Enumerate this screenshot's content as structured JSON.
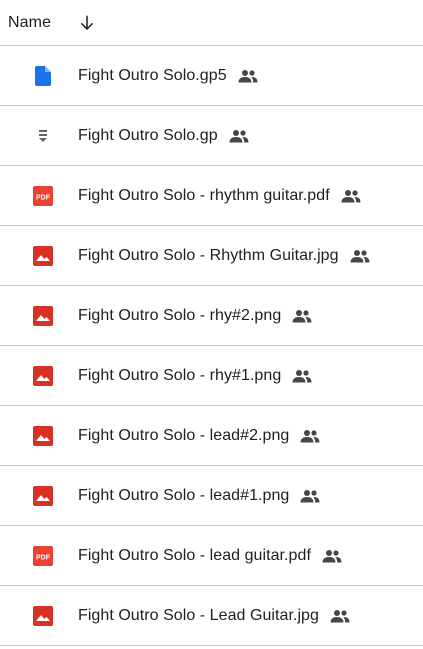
{
  "header": {
    "name_label": "Name",
    "sort_icon": "arrow-down-icon"
  },
  "colors": {
    "doc_blue": "#1a73e8",
    "pdf_red": "#ea4335",
    "image_red": "#d93025",
    "generic_gray": "#5f6368",
    "divider": "#c4c7c5"
  },
  "files": [
    {
      "name": "Fight Outro Solo.gp5",
      "type": "doc",
      "shared": true
    },
    {
      "name": "Fight Outro Solo.gp",
      "type": "generic",
      "shared": true
    },
    {
      "name": "Fight Outro Solo - rhythm guitar.pdf",
      "type": "pdf",
      "shared": true
    },
    {
      "name": "Fight Outro Solo - Rhythm Guitar.jpg",
      "type": "image",
      "shared": true
    },
    {
      "name": "Fight Outro Solo - rhy#2.png",
      "type": "image",
      "shared": true
    },
    {
      "name": "Fight Outro Solo - rhy#1.png",
      "type": "image",
      "shared": true
    },
    {
      "name": "Fight Outro Solo - lead#2.png",
      "type": "image",
      "shared": true
    },
    {
      "name": "Fight Outro Solo - lead#1.png",
      "type": "image",
      "shared": true
    },
    {
      "name": "Fight Outro Solo - lead guitar.pdf",
      "type": "pdf",
      "shared": true
    },
    {
      "name": "Fight Outro Solo - Lead Guitar.jpg",
      "type": "image",
      "shared": true
    }
  ]
}
